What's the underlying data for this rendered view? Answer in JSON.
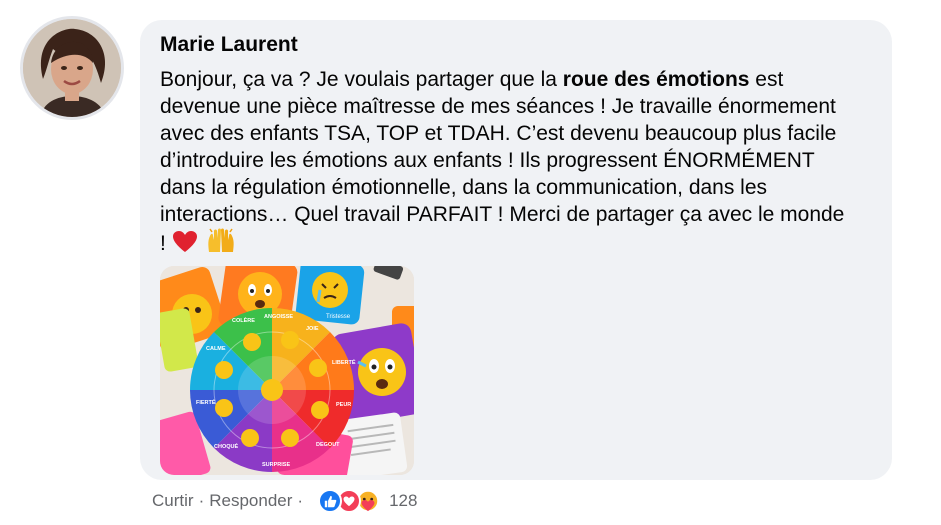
{
  "comment": {
    "author": "Marie Laurent",
    "text_part1": "Bonjour, ça va ? Je voulais partager que la ",
    "text_bold": "roue des émotions",
    "text_part2": " est devenue une pièce maîtresse de mes séances ! Je travaille énormement avec des enfants TSA, TOP et TDAH. C’est devenu beaucoup plus facile d’introduire les émotions aux enfants ! Ils progressent ÉNORMÉMENT dans la régulation émotionnelle, dans la communication, dans les interactions… Quel travail PARFAIT ! Merci de partager ça avec le monde ! ",
    "emojis": [
      "heart-emoji",
      "raising-hands-emoji"
    ]
  },
  "image": {
    "wheel_labels": [
      "CALME",
      "COLÈRE",
      "ANGOISSE",
      "JOIE",
      "LIBERTÉ",
      "PEUR",
      "DEGOUT",
      "TRISTESSE",
      "SURPRISE",
      "CHOQUÉ",
      "FIERTÉ"
    ],
    "card_label": "Tristesse"
  },
  "actions": {
    "like_label": "Curtir",
    "separator": "·",
    "reply_label": "Responder",
    "reactions": [
      "like-reaction",
      "love-reaction",
      "care-reaction"
    ],
    "reaction_count": "128"
  },
  "colors": {
    "bubble_bg": "#f0f2f5",
    "like_blue": "#1877f2",
    "love_red": "#f33e58",
    "meta_gray": "#65676b"
  }
}
